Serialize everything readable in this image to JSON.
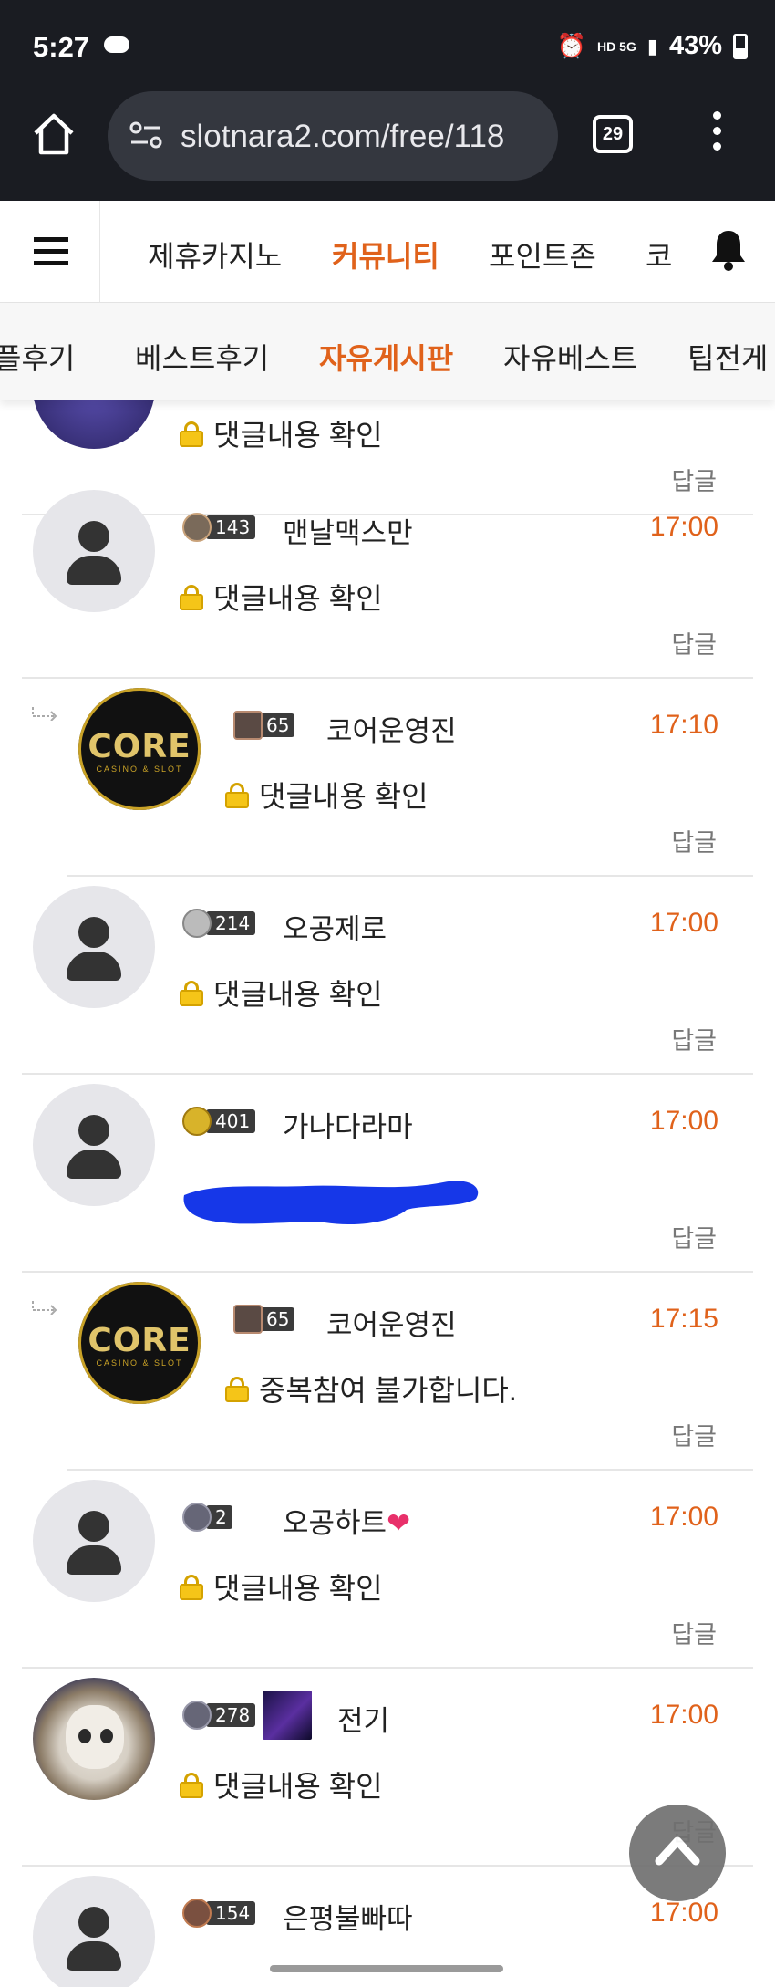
{
  "status_bar": {
    "time": "5:27",
    "network": "HD 5G",
    "battery": "43%"
  },
  "browser": {
    "url": "slotnara2.com/free/118",
    "tab_count": "29"
  },
  "main_nav": {
    "items": [
      "제휴카지노",
      "커뮤니티",
      "포인트존",
      "코"
    ],
    "active": "커뮤니티"
  },
  "sub_nav": {
    "items": [
      "플후기",
      "베스트후기",
      "자유게시판",
      "자유베스트",
      "팁전게"
    ],
    "active": "자유게시판"
  },
  "comments": [
    {
      "user": "",
      "level": "",
      "time": "",
      "content": "댓글내용 확인",
      "reply_label": "답글",
      "avatar": "cut-off"
    },
    {
      "user": "맨날맥스만",
      "level": "143",
      "time": "17:00",
      "content": "댓글내용 확인",
      "reply_label": "답글",
      "avatar": "default"
    },
    {
      "user": "코어운영진",
      "level": "65",
      "time": "17:10",
      "content": "댓글내용 확인",
      "reply_label": "답글",
      "avatar": "core",
      "is_reply": true
    },
    {
      "user": "오공제로",
      "level": "214",
      "time": "17:00",
      "content": "댓글내용 확인",
      "reply_label": "답글",
      "avatar": "default"
    },
    {
      "user": "가나다라마",
      "level": "401",
      "time": "17:00",
      "content": "",
      "reply_label": "답글",
      "avatar": "default",
      "redacted": true
    },
    {
      "user": "코어운영진",
      "level": "65",
      "time": "17:15",
      "content": "중복참여 불가합니다.",
      "reply_label": "답글",
      "avatar": "core",
      "is_reply": true
    },
    {
      "user": "오공하트",
      "user_suffix": "❤",
      "level": "2",
      "time": "17:00",
      "content": "댓글내용 확인",
      "reply_label": "답글",
      "avatar": "default"
    },
    {
      "user": "전기",
      "level": "278",
      "time": "17:00",
      "content": "댓글내용 확인",
      "reply_label": "답글",
      "avatar": "cat"
    },
    {
      "user": "은평불빠따",
      "level": "154",
      "time": "17:00",
      "content": "",
      "reply_label": "",
      "avatar": "default"
    }
  ],
  "core_logo": {
    "text": "CORE",
    "sub": "CASINO & SLOT"
  },
  "colors": {
    "accent": "#e0621b",
    "dark_bar": "#1a1c22",
    "redaction": "#1637e8"
  },
  "icons": [
    "home-icon",
    "site-info-icon",
    "tabs-icon",
    "more-icon",
    "menu-icon",
    "bell-icon",
    "lock-icon",
    "reply-arrow-icon",
    "chevron-up-icon"
  ]
}
